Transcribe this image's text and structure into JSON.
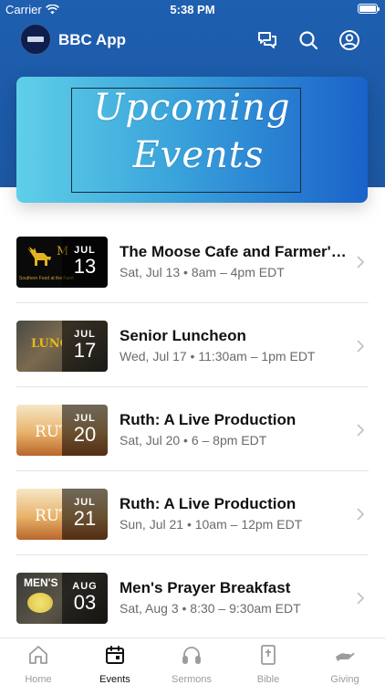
{
  "status_bar": {
    "carrier": "Carrier",
    "time": "5:38 PM"
  },
  "app_bar": {
    "title": "BBC App",
    "icons": [
      "chat-bubbles-icon",
      "search-icon",
      "account-icon"
    ]
  },
  "banner": {
    "line1": "Upcoming",
    "line2": "Events"
  },
  "events": [
    {
      "title": "The Moose Cafe and Farmer's...",
      "subtitle": "Sat, Jul 13 • 8am – 4pm EDT",
      "month": "JUL",
      "day": "13",
      "thumb_text": "Moose Cafe",
      "thumb_caption": "Southern Food at the Farm"
    },
    {
      "title": "Senior Luncheon",
      "subtitle": "Wed, Jul 17 • 11:30am – 1pm EDT",
      "month": "JUL",
      "day": "17",
      "thumb_text": "LUNCHEON"
    },
    {
      "title": "Ruth: A Live Production",
      "subtitle": "Sat, Jul 20 • 6 – 8pm EDT",
      "month": "JUL",
      "day": "20",
      "thumb_text": "RUTH"
    },
    {
      "title": "Ruth: A Live Production",
      "subtitle": "Sun, Jul 21 • 10am – 12pm EDT",
      "month": "JUL",
      "day": "21",
      "thumb_text": "RUTH"
    },
    {
      "title": "Men's Prayer Breakfast",
      "subtitle": "Sat, Aug 3 • 8:30 – 9:30am EDT",
      "month": "AUG",
      "day": "03",
      "thumb_text": "MEN'S"
    }
  ],
  "tab_bar": {
    "active": "Events",
    "tabs": [
      {
        "label": "Home",
        "icon": "home-icon"
      },
      {
        "label": "Events",
        "icon": "calendar-icon"
      },
      {
        "label": "Sermons",
        "icon": "headphones-icon"
      },
      {
        "label": "Bible",
        "icon": "bible-icon"
      },
      {
        "label": "Giving",
        "icon": "giving-hand-icon"
      }
    ]
  },
  "colors": {
    "header": "#1f5fb0",
    "active_tab": "#111111",
    "inactive_tab": "#9b9ba0"
  }
}
